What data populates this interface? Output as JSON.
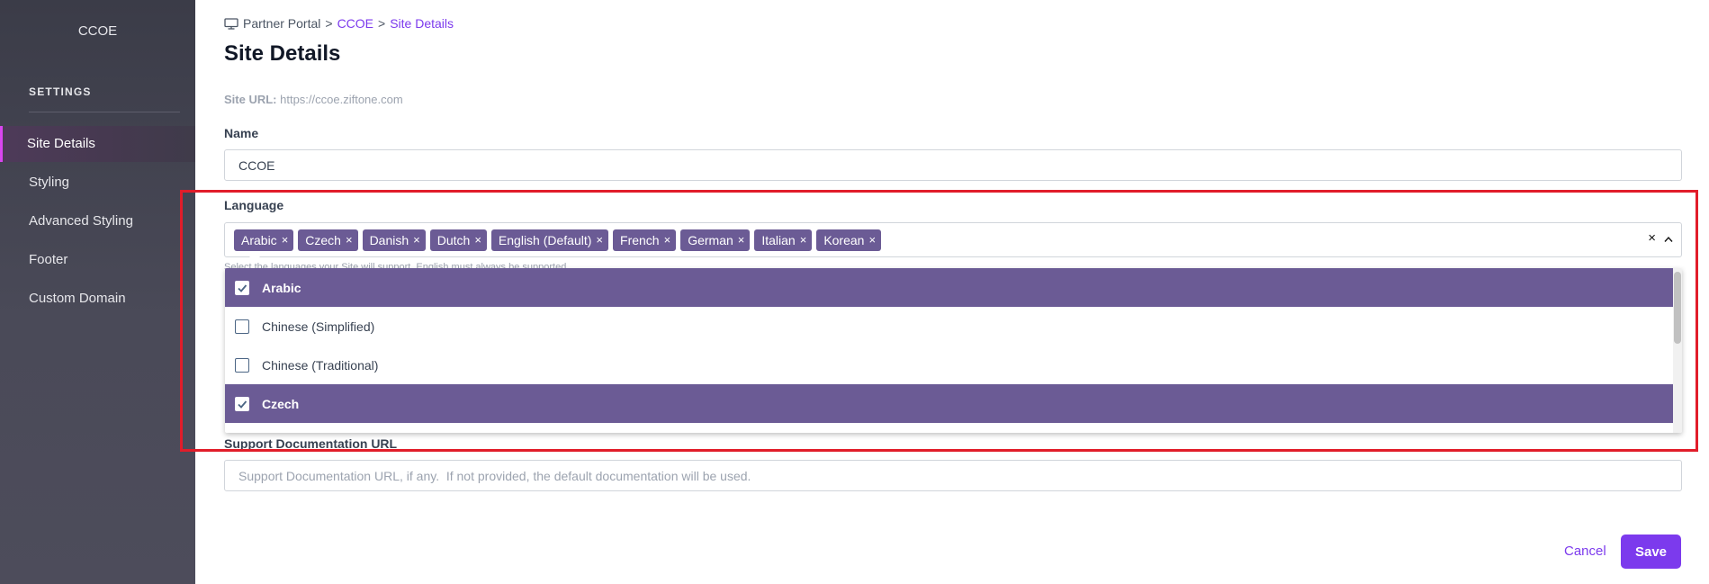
{
  "sidebar": {
    "brand": "CCOE",
    "section_title": "SETTINGS",
    "items": [
      {
        "label": "Site Details",
        "active": true
      },
      {
        "label": "Styling",
        "active": false
      },
      {
        "label": "Advanced Styling",
        "active": false
      },
      {
        "label": "Footer",
        "active": false
      },
      {
        "label": "Custom Domain",
        "active": false
      }
    ]
  },
  "breadcrumb": {
    "items": [
      "Partner Portal",
      "CCOE",
      "Site Details"
    ],
    "separator": ">"
  },
  "page": {
    "title": "Site Details",
    "site_url_label": "Site URL:",
    "site_url_value": "https://ccoe.ziftone.com"
  },
  "form": {
    "name_label": "Name",
    "name_value": "CCOE",
    "language_label": "Language",
    "selected_languages": [
      "Arabic",
      "Czech",
      "Danish",
      "Dutch",
      "English (Default)",
      "French",
      "German",
      "Italian",
      "Korean"
    ],
    "chip_remove_glyph": "×",
    "clear_glyph": "×",
    "language_helper": "Select the languages your Site will support. English must always be supported.",
    "language_options": [
      {
        "label": "Arabic",
        "checked": true
      },
      {
        "label": "Chinese (Simplified)",
        "checked": false
      },
      {
        "label": "Chinese (Traditional)",
        "checked": false
      },
      {
        "label": "Czech",
        "checked": true
      }
    ],
    "support_doc_label": "Support Documentation URL",
    "support_doc_placeholder": "Support Documentation URL, if any.  If not provided, the default documentation will be used."
  },
  "actions": {
    "cancel_label": "Cancel",
    "save_label": "Save"
  },
  "colors": {
    "accent": "#7c3aed",
    "chip": "#6b5b95",
    "active_bar": "#d946ef",
    "highlight": "#e11d2a"
  }
}
